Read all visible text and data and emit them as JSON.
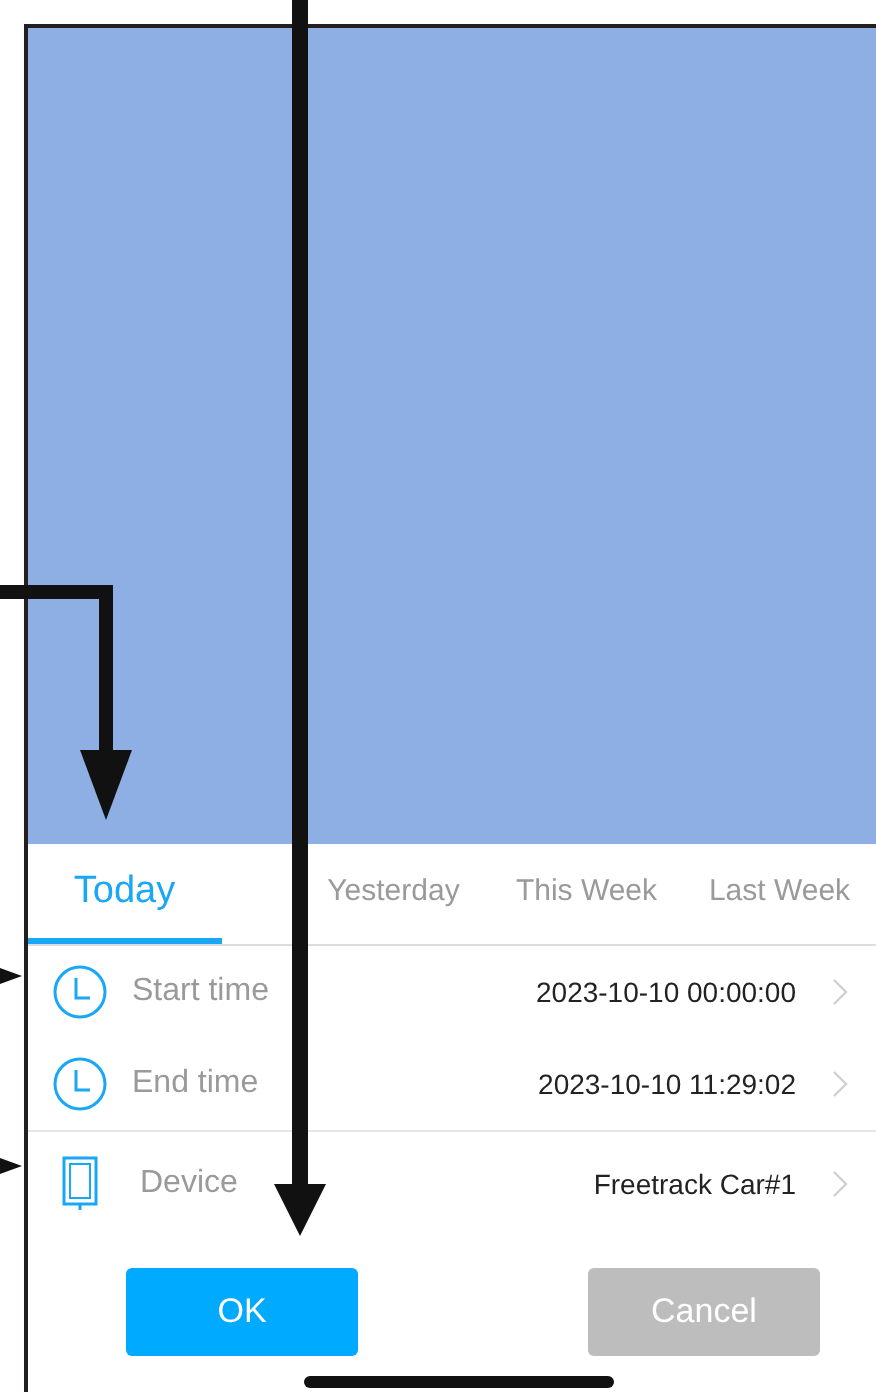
{
  "tabs": [
    {
      "label": "Today",
      "selected": true
    },
    {
      "label": "Yesterday",
      "selected": false
    },
    {
      "label": "This Week",
      "selected": false
    },
    {
      "label": "Last Week",
      "selected": false
    }
  ],
  "rows": [
    {
      "kind": "clock",
      "label": "Start time",
      "value": "2023-10-10 00:00:00"
    },
    {
      "kind": "clock",
      "label": "End time",
      "value": "2023-10-10 11:29:02"
    },
    {
      "kind": "device",
      "label": "Device",
      "value": "Freetrack Car#1"
    }
  ],
  "buttons": [
    {
      "kind": "primary",
      "label": "OK"
    },
    {
      "kind": "secondary",
      "label": "Cancel"
    }
  ]
}
